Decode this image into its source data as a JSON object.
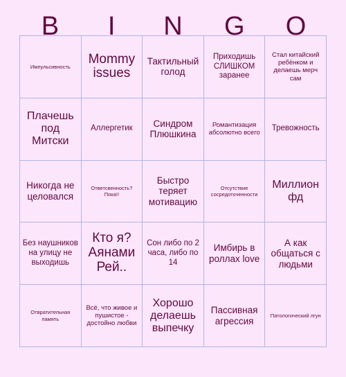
{
  "title": {
    "letters": [
      "B",
      "I",
      "N",
      "G",
      "O"
    ]
  },
  "colors": {
    "background": "#fce6fb",
    "cell_background": "#fce6fb",
    "grid_border": "#aeb4e8",
    "text": "#61073f"
  },
  "grid": {
    "rows": 5,
    "columns": 5,
    "cells": [
      {
        "text": "Импульсивность",
        "size": "xs"
      },
      {
        "text": "Mommy issues",
        "size": "xxl"
      },
      {
        "text": "Тактильный голод",
        "size": "lg"
      },
      {
        "text": "Приходишь СЛИШКОМ заранее",
        "size": "md"
      },
      {
        "text": "Стал китайский ребёнком и делаешь мерч сам",
        "size": "sm"
      },
      {
        "text": "Плачешь под Митски",
        "size": "xl"
      },
      {
        "text": "Аллергетик",
        "size": "md"
      },
      {
        "text": "Синдром Плюшкина",
        "size": "lg"
      },
      {
        "text": "Романтизация абсолютно всего",
        "size": "sm"
      },
      {
        "text": "Тревожность",
        "size": "md"
      },
      {
        "text": "Никогда не целовался",
        "size": "lg"
      },
      {
        "text": "Ответсвенность? Пока!!",
        "size": "xs"
      },
      {
        "text": "Быстро теряет мотивацию",
        "size": "lg"
      },
      {
        "text": "Отсутствие сосредоточенности",
        "size": "xs"
      },
      {
        "text": "Миллион фд",
        "size": "xl"
      },
      {
        "text": "Без наушников на улицу не выходишь",
        "size": "md"
      },
      {
        "text": "Кто я? Аянами Рей..",
        "size": "xxl"
      },
      {
        "text": "Сон либо по 2 часа, либо по 14",
        "size": "md"
      },
      {
        "text": "Имбирь в роллах love",
        "size": "lg"
      },
      {
        "text": "А как общаться с людьми",
        "size": "lg"
      },
      {
        "text": "Отвратительная память",
        "size": "xs"
      },
      {
        "text": "Всё, что живое и пушистое - достойно любви",
        "size": "sm"
      },
      {
        "text": "Хорошо делаешь выпечку",
        "size": "xl"
      },
      {
        "text": "Пассивная агрессия",
        "size": "lg"
      },
      {
        "text": "Патологический лгун",
        "size": "xs"
      }
    ]
  }
}
